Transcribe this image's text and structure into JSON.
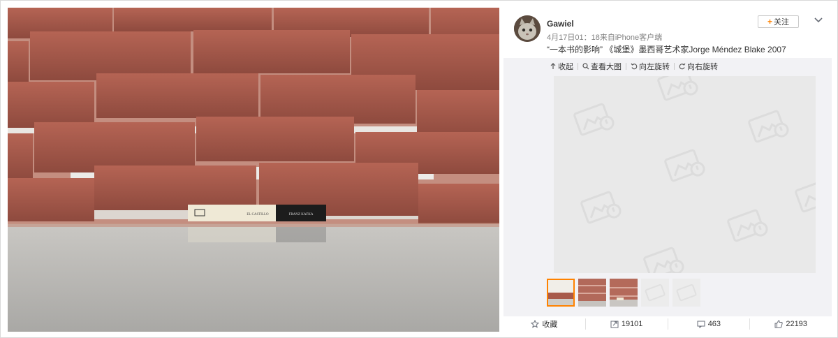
{
  "post": {
    "username": "Gawiel",
    "meta": "4月17日01：18来自iPhone客户端",
    "text": "“一本书的影响” 《城堡》墨西哥艺术家Jorge Méndez Blake 2007"
  },
  "header": {
    "follow_label": "关注",
    "follow_icon": "+"
  },
  "toolbar": {
    "collapse": "收起",
    "view_large": "查看大图",
    "rotate_left": "向左旋转",
    "rotate_right": "向右旋转"
  },
  "book": {
    "title_left": "EL CASTILLO",
    "title_right": "FRANZ KAFKA"
  },
  "footer": {
    "favorite": "收藏",
    "reposts": "19101",
    "comments": "463",
    "likes": "22193"
  },
  "thumbnails": {
    "count": 5,
    "active_index": 0
  },
  "colors": {
    "accent": "#ff8200",
    "brick": "#a8584a",
    "panel_bg": "#f2f2f5"
  },
  "icons": [
    "upload-icon",
    "search-icon",
    "rotate-left-icon",
    "rotate-right-icon",
    "star-icon",
    "share-icon",
    "comment-icon",
    "like-icon",
    "chevron-down-icon",
    "image-placeholder-icon"
  ]
}
